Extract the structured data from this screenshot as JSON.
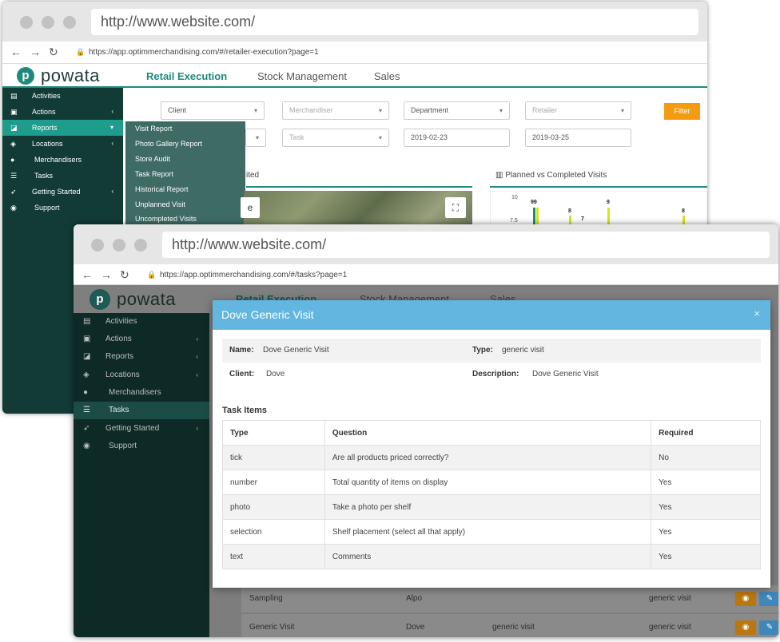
{
  "back_window": {
    "address_bar": "http://www.website.com/",
    "url": "https://app.optimmerchandising.com/#/retailer-execution?page=1",
    "logo": "powata",
    "nav": [
      "Retail Execution",
      "Stock Management",
      "Sales"
    ],
    "sidebar": [
      {
        "label": "Activities",
        "icon": "chart-icon"
      },
      {
        "label": "Actions",
        "icon": "calendar-icon"
      },
      {
        "label": "Reports",
        "icon": "line-chart-icon"
      },
      {
        "label": "Locations",
        "icon": "map-icon"
      },
      {
        "label": "Merchandisers",
        "icon": "user-icon"
      },
      {
        "label": "Tasks",
        "icon": "list-icon"
      },
      {
        "label": "Getting Started",
        "icon": "rocket-icon"
      },
      {
        "label": "Support",
        "icon": "support-icon"
      }
    ],
    "reports_submenu": [
      "Visit Report",
      "Photo Gallery Report",
      "Store Audit",
      "Task Report",
      "Historical Report",
      "Unplanned Visit",
      "Uncompleted Visits"
    ],
    "filters": {
      "client": "Client",
      "merchandiser": "Merchandiser",
      "department": "Department",
      "retailer": "Retailer",
      "task": "Task",
      "date_from": "2019-02-23",
      "date_to": "2019-03-25",
      "filter_button": "Filter"
    },
    "map_panel_title": "ited",
    "chart_panel_title": "Planned vs Completed Visits",
    "chart_axis_labels": [
      "10",
      "7.5"
    ],
    "chart_value_labels": [
      "99",
      "8",
      "7",
      "9",
      "8"
    ]
  },
  "front_window": {
    "address_bar": "http://www.website.com/",
    "url": "https://app.optimmerchandising.com/#/tasks?page=1",
    "logo": "powata",
    "nav": [
      "Retail Execution",
      "Stock Management",
      "Sales"
    ],
    "sidebar": [
      {
        "label": "Activities",
        "icon": "chart-icon"
      },
      {
        "label": "Actions",
        "icon": "calendar-icon"
      },
      {
        "label": "Reports",
        "icon": "line-chart-icon"
      },
      {
        "label": "Locations",
        "icon": "map-icon"
      },
      {
        "label": "Merchandisers",
        "icon": "user-icon"
      },
      {
        "label": "Tasks",
        "icon": "list-icon"
      },
      {
        "label": "Getting Started",
        "icon": "rocket-icon"
      },
      {
        "label": "Support",
        "icon": "support-icon"
      }
    ],
    "background_rows": [
      {
        "name": "Sampling",
        "client": "Alpo",
        "description": "",
        "type": "generic visit"
      },
      {
        "name": "Generic Visit",
        "client": "Dove",
        "description": "generic visit",
        "type": "generic visit"
      }
    ],
    "modal": {
      "title": "Dove Generic Visit",
      "close": "×",
      "name_label": "Name:",
      "name_value": "Dove Generic Visit",
      "type_label": "Type:",
      "type_value": "generic visit",
      "client_label": "Client:",
      "client_value": "Dove",
      "description_label": "Description:",
      "description_value": "Dove Generic Visit",
      "section_title": "Task Items",
      "columns": [
        "Type",
        "Question",
        "Required"
      ],
      "rows": [
        {
          "type": "tick",
          "question": "Are all products priced correctly?",
          "required": "No"
        },
        {
          "type": "number",
          "question": "Total quantity of items on display",
          "required": "Yes"
        },
        {
          "type": "photo",
          "question": "Take a photo per shelf",
          "required": "Yes"
        },
        {
          "type": "selection",
          "question": "Shelf placement (select all that apply)",
          "required": "Yes"
        },
        {
          "type": "text",
          "question": "Comments",
          "required": "Yes"
        }
      ]
    }
  },
  "colors": {
    "brand": "#1e8a7d",
    "sidebar": "#123b35",
    "filter_button": "#f39c12",
    "modal_header": "#62b6e0"
  }
}
